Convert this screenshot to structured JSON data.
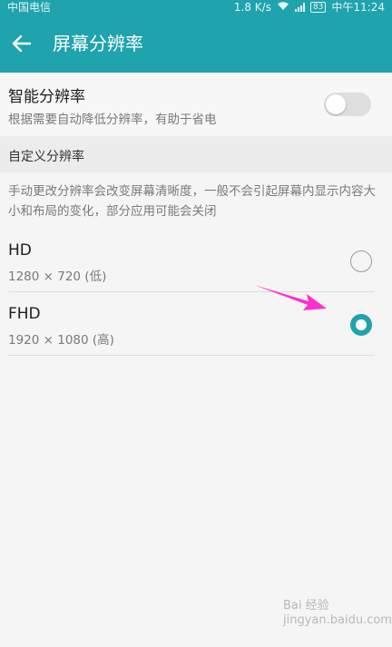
{
  "status_bar": {
    "carrier": "中国电信",
    "speed": "1.8 K/s",
    "battery": "83",
    "time": "中午11:24"
  },
  "app_bar": {
    "back_icon": "arrow-left-icon",
    "title": "屏幕分辨率"
  },
  "smart_resolution": {
    "title": "智能分辨率",
    "subtitle": "根据需要自动降低分辨率，有助于省电",
    "enabled": false
  },
  "custom_section": {
    "header": "自定义分辨率",
    "description": "手动更改分辨率会改变屏幕清晰度，一般不会引起屏幕内显示内容大小和布局的变化，部分应用可能会关闭"
  },
  "options": [
    {
      "name": "HD",
      "spec": "1280 × 720 (低)",
      "selected": false
    },
    {
      "name": "FHD",
      "spec": "1920 × 1080 (高)",
      "selected": true
    }
  ],
  "colors": {
    "accent": "#1fa3ad",
    "annotation_arrow": "#ff2fd0"
  },
  "watermark": {
    "line1": "Bai 经验",
    "line2": "jingyan.baidu.com"
  }
}
